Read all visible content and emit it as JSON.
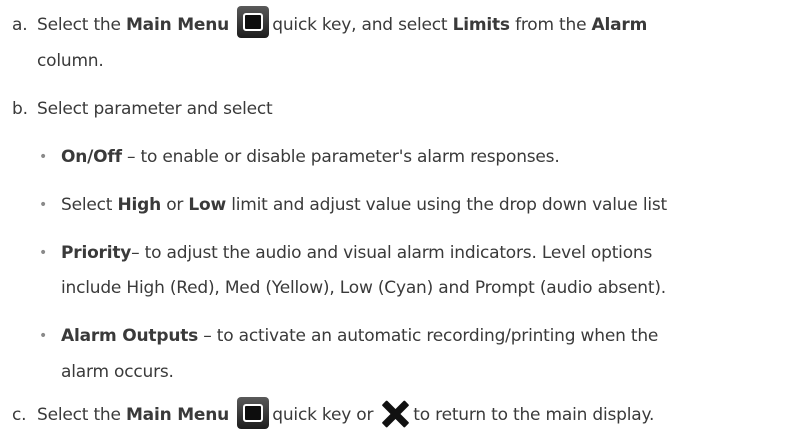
{
  "steps": [
    {
      "marker": "a.",
      "p1": "Select the ",
      "b1": "Main Menu",
      "p2": " quick key, and select ",
      "b2": "Limits",
      "p3": " from the ",
      "b3": "Alarm",
      "cont": "column."
    },
    {
      "marker": "b.",
      "text": "Select parameter and select"
    },
    {
      "marker": "c.",
      "p1": "Select the ",
      "b1": "Main Menu",
      "p2": " quick key or ",
      "p3": " to return to the main display."
    }
  ],
  "bullets": [
    {
      "bold": "On/Off",
      "text": " – to enable or disable parameter's alarm responses."
    },
    {
      "p1": "Select ",
      "b1": "High",
      "p2": " or ",
      "b2": "Low",
      "p3": " limit and adjust value using the drop down value list"
    },
    {
      "bold": "Priority",
      "text": "– to adjust the audio and visual alarm indicators. Level options",
      "cont": "include High (Red), Med (Yellow), Low (Cyan) and Prompt (audio absent)."
    },
    {
      "bold": "Alarm Outputs",
      "text": " – to activate an automatic recording/printing when the",
      "cont": "alarm occurs."
    }
  ],
  "bullet_char": "•",
  "icons": {
    "main_menu": "main-menu-icon",
    "close": "close-icon"
  }
}
